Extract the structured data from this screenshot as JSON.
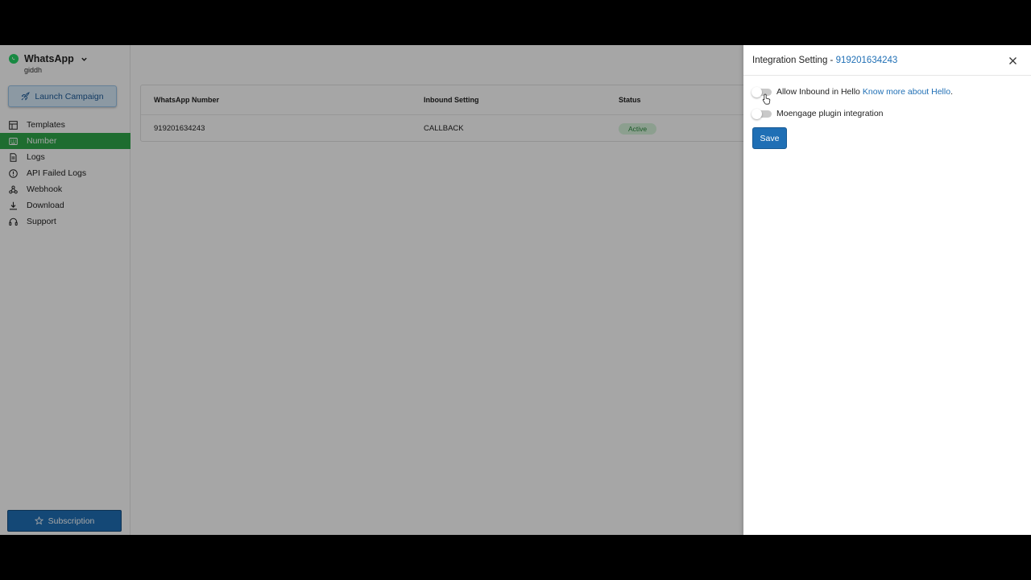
{
  "sidebar": {
    "brand_title": "WhatsApp",
    "brand_subtitle": "giddh",
    "launch_label": "Launch Campaign",
    "items": [
      {
        "label": "Templates",
        "icon": "table-icon",
        "active": false
      },
      {
        "label": "Number",
        "icon": "keypad-icon",
        "active": true
      },
      {
        "label": "Logs",
        "icon": "document-icon",
        "active": false
      },
      {
        "label": "API Failed Logs",
        "icon": "alert-circle-icon",
        "active": false
      },
      {
        "label": "Webhook",
        "icon": "webhook-icon",
        "active": false
      },
      {
        "label": "Download",
        "icon": "download-icon",
        "active": false
      },
      {
        "label": "Support",
        "icon": "headset-icon",
        "active": false
      }
    ],
    "subscription_label": "Subscription"
  },
  "table": {
    "headers": [
      "WhatsApp Number",
      "Inbound Setting",
      "Status"
    ],
    "rows": [
      {
        "number": "919201634243",
        "inbound": "CALLBACK",
        "status": "Active"
      }
    ]
  },
  "drawer": {
    "title_prefix": "Integration Setting - ",
    "title_number": "919201634243",
    "option1_label": "Allow Inbound in Hello",
    "option1_link": "Know more about Hello",
    "option1_suffix": ".",
    "option2_label": "Moengage plugin integration",
    "save_label": "Save"
  },
  "colors": {
    "accent": "#1f6fb5",
    "active_nav": "#2ea84a",
    "status_active": "#2a8a3e"
  }
}
